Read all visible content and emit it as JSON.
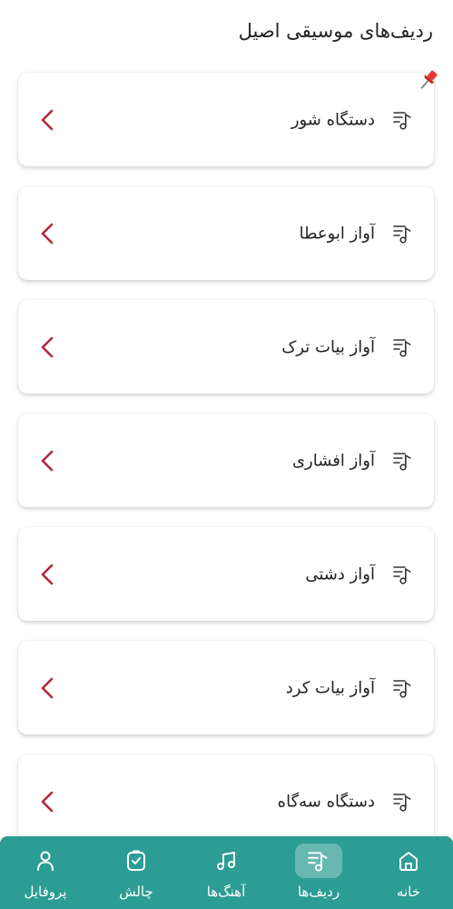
{
  "header": {
    "title": "ردیف‌های موسیقی اصیل"
  },
  "radif_list": [
    {
      "label": "دستگاه شور",
      "pinned": true
    },
    {
      "label": "آواز ابوعطا",
      "pinned": false
    },
    {
      "label": "آواز بیات ترک",
      "pinned": false
    },
    {
      "label": "آواز افشاری",
      "pinned": false
    },
    {
      "label": "آواز دشتی",
      "pinned": false
    },
    {
      "label": "آواز بیات کرد",
      "pinned": false
    },
    {
      "label": "دستگاه سه‌گاه",
      "pinned": false
    }
  ],
  "bottom_nav": {
    "home": {
      "label": "خانه",
      "icon": "home-icon"
    },
    "radifs": {
      "label": "ردیف‌ها",
      "icon": "music-list-icon",
      "active": true
    },
    "songs": {
      "label": "آهنگ‌ها",
      "icon": "music-notes-icon"
    },
    "challenge": {
      "label": "چالش",
      "icon": "clipboard-check-icon"
    },
    "profile": {
      "label": "پروفایل",
      "icon": "user-icon"
    }
  },
  "colors": {
    "accent": "#2c9d94",
    "chevron": "#b0283c",
    "pin": "#e53935"
  }
}
